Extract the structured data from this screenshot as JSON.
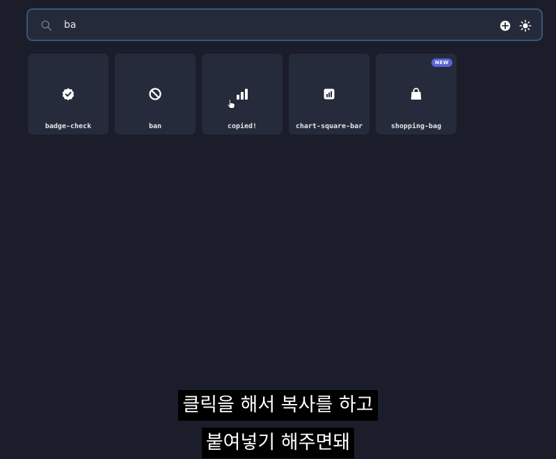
{
  "search": {
    "value": "ba",
    "icon": "search-icon"
  },
  "header": {
    "add_icon": "plus-circle-icon",
    "theme_icon": "sun-icon"
  },
  "results": [
    {
      "label": "badge-check",
      "icon": "badge-check-icon"
    },
    {
      "label": "ban",
      "icon": "ban-icon"
    },
    {
      "label": "copied!",
      "icon": "bar-chart-icon"
    },
    {
      "label": "chart-square-bar",
      "icon": "chart-square-bar-icon"
    },
    {
      "label": "shopping-bag",
      "icon": "shopping-bag-icon",
      "badge": "NEW"
    }
  ],
  "subtitles": {
    "line1": "클릭을 해서 복사를 하고",
    "line2": "붙여넣기 해주면돼"
  },
  "colors": {
    "background": "#1b1d2a",
    "card": "#262b3b",
    "search_border": "#3b5579",
    "badge": "#5b64d8"
  }
}
